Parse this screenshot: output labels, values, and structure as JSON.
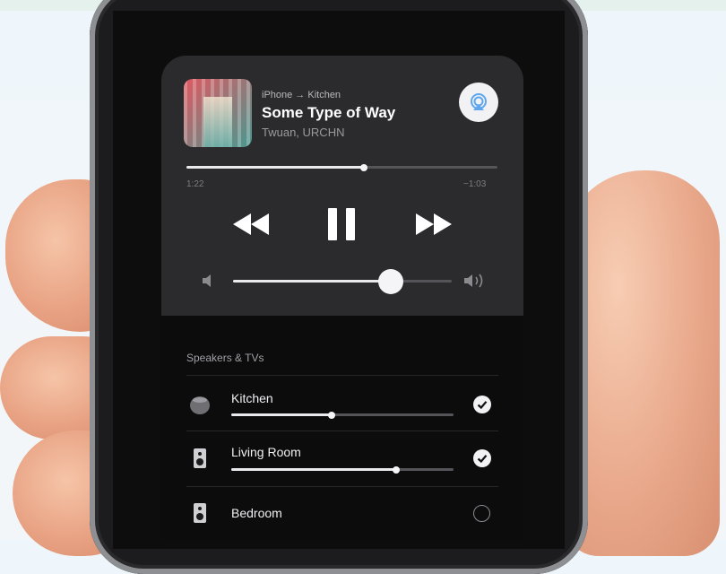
{
  "now_playing": {
    "route": "iPhone → Kitchen",
    "title": "Some Type of Way",
    "artist": "Twuan, URCHN",
    "elapsed": "1:22",
    "remaining": "−1:03",
    "progress": 0.57,
    "volume": 0.72
  },
  "speakers": {
    "section_title": "Speakers & TVs",
    "items": [
      {
        "label": "Kitchen",
        "selected": true,
        "volume": 0.45
      },
      {
        "label": "Living Room",
        "selected": true,
        "volume": 0.74
      },
      {
        "label": "Bedroom",
        "selected": false
      }
    ]
  },
  "icons": {
    "airplay": "airplay-icon",
    "rewind": "rewind-icon",
    "pause": "pause-icon",
    "fast_forward": "fast-forward-icon",
    "volume_low": "speaker-low-icon",
    "volume_high": "speaker-high-icon",
    "homepod": "homepod-icon",
    "speaker": "speaker-icon",
    "check": "checkmark-icon"
  },
  "colors": {
    "accent": "#5ea7ee",
    "card_bg": "#2b2b2d"
  }
}
